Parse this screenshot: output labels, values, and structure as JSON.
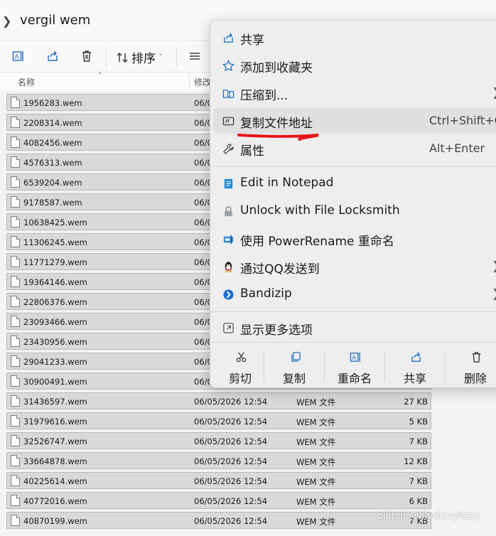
{
  "address": {
    "path": "vergil wem"
  },
  "toolbar": {
    "sort_label": "排序"
  },
  "columns": {
    "name": "名称",
    "modified": "修改"
  },
  "files": [
    {
      "name": "1956283.wem",
      "date": "06/0"
    },
    {
      "name": "2208314.wem",
      "date": "06/0"
    },
    {
      "name": "4082456.wem",
      "date": "06/0"
    },
    {
      "name": "4576313.wem",
      "date": "06/0"
    },
    {
      "name": "6539204.wem",
      "date": "06/0"
    },
    {
      "name": "9178587.wem",
      "date": "06/0"
    },
    {
      "name": "10638425.wem",
      "date": "06/0"
    },
    {
      "name": "11306245.wem",
      "date": "06/0"
    },
    {
      "name": "11771279.wem",
      "date": "06/0"
    },
    {
      "name": "19364146.wem",
      "date": "06/0"
    },
    {
      "name": "22806376.wem",
      "date": "06/0"
    },
    {
      "name": "23093466.wem",
      "date": "06/0"
    },
    {
      "name": "23430956.wem",
      "date": "06/0"
    },
    {
      "name": "29041233.wem",
      "date": "06/0"
    },
    {
      "name": "30900491.wem",
      "date": "06/0"
    },
    {
      "name": "31436597.wem",
      "date": "06/05/2026 12:54",
      "type": "WEM 文件",
      "size": "27 KB"
    },
    {
      "name": "31979616.wem",
      "date": "06/05/2026 12:54",
      "type": "WEM 文件",
      "size": "5 KB"
    },
    {
      "name": "32526747.wem",
      "date": "06/05/2026 12:54",
      "type": "WEM 文件",
      "size": "7 KB"
    },
    {
      "name": "33664878.wem",
      "date": "06/05/2026 12:54",
      "type": "WEM 文件",
      "size": "12 KB"
    },
    {
      "name": "40225614.wem",
      "date": "06/05/2026 12:54",
      "type": "WEM 文件",
      "size": "7 KB"
    },
    {
      "name": "40772016.wem",
      "date": "06/05/2026 12:54",
      "type": "WEM 文件",
      "size": "6 KB"
    },
    {
      "name": "40870199.wem",
      "date": "06/05/2026 12:54",
      "type": "WEM 文件",
      "size": "7 KB"
    }
  ],
  "menu": {
    "share": "共享",
    "favorites": "添加到收藏夹",
    "compress": "压缩到...",
    "copy_path": "复制文件地址",
    "copy_path_shortcut": "Ctrl+Shift+C",
    "properties": "属性",
    "properties_shortcut": "Alt+Enter",
    "notepad": "Edit in Notepad",
    "locksmith": "Unlock with File Locksmith",
    "powerrename": "使用 PowerRename 重命名",
    "qq": "通过QQ发送到",
    "bandizip": "Bandizip",
    "more": "显示更多选项",
    "bottom": {
      "cut": "剪切",
      "copy": "复制",
      "rename": "重命名",
      "share": "共享",
      "delete": "删除"
    }
  },
  "colors": {
    "annotation": "#e8141b",
    "menu_bg": "#eeeeee",
    "row_bg": "#d9d9d9"
  },
  "watermark": "bilibili @lilydizzylizzy"
}
